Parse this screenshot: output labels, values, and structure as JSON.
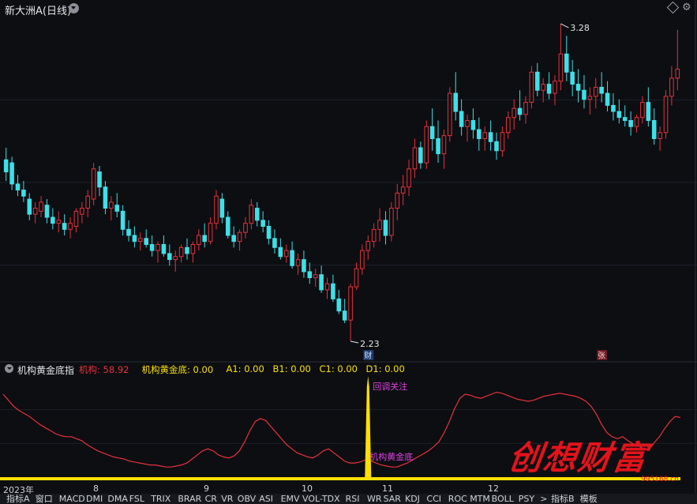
{
  "window": {
    "title": "新大洲A(日线)"
  },
  "chart_data": [
    {
      "type": "candlestick",
      "name": "新大洲A(日线)",
      "period": "日线",
      "y_range": [
        2.23,
        3.28
      ],
      "annotations": {
        "high_label": "3.28",
        "low_label": "2.23",
        "marker_cai": "财",
        "marker_zhang": "张"
      },
      "x_ticks": [
        "2023年",
        "8",
        "9",
        "10",
        "11",
        "12"
      ],
      "ohlc": [
        [
          2.83,
          2.87,
          2.76,
          2.79
        ],
        [
          2.82,
          2.84,
          2.73,
          2.75
        ],
        [
          2.75,
          2.78,
          2.71,
          2.73
        ],
        [
          2.73,
          2.76,
          2.69,
          2.71
        ],
        [
          2.7,
          2.72,
          2.63,
          2.65
        ],
        [
          2.65,
          2.69,
          2.62,
          2.67
        ],
        [
          2.66,
          2.71,
          2.64,
          2.69
        ],
        [
          2.68,
          2.7,
          2.62,
          2.64
        ],
        [
          2.64,
          2.67,
          2.6,
          2.62
        ],
        [
          2.62,
          2.66,
          2.59,
          2.63
        ],
        [
          2.62,
          2.65,
          2.58,
          2.6
        ],
        [
          2.6,
          2.64,
          2.57,
          2.62
        ],
        [
          2.61,
          2.67,
          2.59,
          2.66
        ],
        [
          2.65,
          2.69,
          2.62,
          2.67
        ],
        [
          2.67,
          2.73,
          2.64,
          2.71
        ],
        [
          2.7,
          2.82,
          2.68,
          2.8
        ],
        [
          2.79,
          2.81,
          2.71,
          2.74
        ],
        [
          2.74,
          2.76,
          2.65,
          2.67
        ],
        [
          2.67,
          2.71,
          2.63,
          2.69
        ],
        [
          2.68,
          2.72,
          2.64,
          2.66
        ],
        [
          2.66,
          2.68,
          2.58,
          2.6
        ],
        [
          2.6,
          2.63,
          2.56,
          2.58
        ],
        [
          2.58,
          2.61,
          2.54,
          2.56
        ],
        [
          2.56,
          2.59,
          2.53,
          2.57
        ],
        [
          2.57,
          2.6,
          2.54,
          2.55
        ],
        [
          2.55,
          2.58,
          2.51,
          2.53
        ],
        [
          2.53,
          2.56,
          2.49,
          2.55
        ],
        [
          2.55,
          2.58,
          2.51,
          2.52
        ],
        [
          2.52,
          2.55,
          2.48,
          2.5
        ],
        [
          2.5,
          2.53,
          2.46,
          2.51
        ],
        [
          2.51,
          2.55,
          2.49,
          2.54
        ],
        [
          2.54,
          2.57,
          2.5,
          2.52
        ],
        [
          2.52,
          2.56,
          2.49,
          2.55
        ],
        [
          2.55,
          2.6,
          2.53,
          2.58
        ],
        [
          2.58,
          2.62,
          2.54,
          2.56
        ],
        [
          2.56,
          2.64,
          2.55,
          2.62
        ],
        [
          2.62,
          2.73,
          2.6,
          2.71
        ],
        [
          2.7,
          2.72,
          2.62,
          2.64
        ],
        [
          2.64,
          2.66,
          2.57,
          2.58
        ],
        [
          2.58,
          2.61,
          2.54,
          2.56
        ],
        [
          2.56,
          2.6,
          2.53,
          2.59
        ],
        [
          2.59,
          2.64,
          2.57,
          2.62
        ],
        [
          2.62,
          2.7,
          2.6,
          2.68
        ],
        [
          2.67,
          2.69,
          2.61,
          2.63
        ],
        [
          2.63,
          2.66,
          2.59,
          2.61
        ],
        [
          2.61,
          2.63,
          2.55,
          2.57
        ],
        [
          2.57,
          2.6,
          2.52,
          2.54
        ],
        [
          2.54,
          2.57,
          2.5,
          2.51
        ],
        [
          2.51,
          2.55,
          2.49,
          2.53
        ],
        [
          2.53,
          2.56,
          2.47,
          2.48
        ],
        [
          2.48,
          2.52,
          2.45,
          2.5
        ],
        [
          2.5,
          2.53,
          2.44,
          2.46
        ],
        [
          2.46,
          2.49,
          2.42,
          2.44
        ],
        [
          2.44,
          2.47,
          2.41,
          2.45
        ],
        [
          2.45,
          2.48,
          2.39,
          2.4
        ],
        [
          2.4,
          2.44,
          2.37,
          2.42
        ],
        [
          2.42,
          2.45,
          2.36,
          2.37
        ],
        [
          2.37,
          2.4,
          2.32,
          2.33
        ],
        [
          2.33,
          2.37,
          2.29,
          2.3
        ],
        [
          2.3,
          2.42,
          2.23,
          2.41
        ],
        [
          2.41,
          2.49,
          2.4,
          2.47
        ],
        [
          2.47,
          2.55,
          2.45,
          2.53
        ],
        [
          2.53,
          2.58,
          2.5,
          2.56
        ],
        [
          2.56,
          2.62,
          2.54,
          2.6
        ],
        [
          2.6,
          2.67,
          2.56,
          2.63
        ],
        [
          2.63,
          2.66,
          2.55,
          2.58
        ],
        [
          2.58,
          2.69,
          2.56,
          2.67
        ],
        [
          2.67,
          2.75,
          2.63,
          2.72
        ],
        [
          2.72,
          2.78,
          2.68,
          2.74
        ],
        [
          2.74,
          2.83,
          2.71,
          2.8
        ],
        [
          2.8,
          2.9,
          2.77,
          2.87
        ],
        [
          2.87,
          2.89,
          2.8,
          2.82
        ],
        [
          2.82,
          2.96,
          2.8,
          2.94
        ],
        [
          2.94,
          3.0,
          2.86,
          2.9
        ],
        [
          2.9,
          2.96,
          2.82,
          2.85
        ],
        [
          2.85,
          2.93,
          2.8,
          2.91
        ],
        [
          2.91,
          3.07,
          2.89,
          3.05
        ],
        [
          3.05,
          3.12,
          2.96,
          2.99
        ],
        [
          2.99,
          3.03,
          2.91,
          2.94
        ],
        [
          2.94,
          2.98,
          2.89,
          2.96
        ],
        [
          2.96,
          3.0,
          2.9,
          2.93
        ],
        [
          2.93,
          2.97,
          2.86,
          2.9
        ],
        [
          2.9,
          2.94,
          2.86,
          2.92
        ],
        [
          2.92,
          2.96,
          2.86,
          2.89
        ],
        [
          2.89,
          2.92,
          2.83,
          2.86
        ],
        [
          2.86,
          2.94,
          2.84,
          2.92
        ],
        [
          2.92,
          2.99,
          2.9,
          2.97
        ],
        [
          2.97,
          3.03,
          2.93,
          3.0
        ],
        [
          3.0,
          3.06,
          2.96,
          2.98
        ],
        [
          2.98,
          3.04,
          2.95,
          3.02
        ],
        [
          3.02,
          3.14,
          3.0,
          3.12
        ],
        [
          3.12,
          3.15,
          3.04,
          3.06
        ],
        [
          3.06,
          3.1,
          3.02,
          3.08
        ],
        [
          3.08,
          3.12,
          3.03,
          3.05
        ],
        [
          3.05,
          3.11,
          3.01,
          3.09
        ],
        [
          3.09,
          3.28,
          3.06,
          3.18
        ],
        [
          3.18,
          3.24,
          3.09,
          3.12
        ],
        [
          3.12,
          3.16,
          3.04,
          3.08
        ],
        [
          3.08,
          3.13,
          3.02,
          3.06
        ],
        [
          3.06,
          3.11,
          3.0,
          3.03
        ],
        [
          3.03,
          3.07,
          2.98,
          3.04
        ],
        [
          3.04,
          3.1,
          3.0,
          3.07
        ],
        [
          3.07,
          3.12,
          3.02,
          3.05
        ],
        [
          3.05,
          3.09,
          2.99,
          3.01
        ],
        [
          3.01,
          3.05,
          2.96,
          2.99
        ],
        [
          2.99,
          3.03,
          2.95,
          2.97
        ],
        [
          2.97,
          3.01,
          2.94,
          2.96
        ],
        [
          2.96,
          2.99,
          2.91,
          2.94
        ],
        [
          2.94,
          2.98,
          2.92,
          2.97
        ],
        [
          2.97,
          3.04,
          2.95,
          3.02
        ],
        [
          3.02,
          3.07,
          2.94,
          2.96
        ],
        [
          2.96,
          3.0,
          2.88,
          2.9
        ],
        [
          2.9,
          2.94,
          2.86,
          2.92
        ],
        [
          2.92,
          3.06,
          2.9,
          3.04
        ],
        [
          3.04,
          3.14,
          3.01,
          3.1
        ],
        [
          3.1,
          3.26,
          3.06,
          3.13
        ]
      ]
    },
    {
      "type": "line",
      "name": "机构黄金底指",
      "header": {
        "name": "机构黄金底指",
        "series": [
          {
            "label": "机构:",
            "value": "58.92",
            "color": "#e8313a"
          },
          {
            "label": "机构黄金底:",
            "value": "0.00",
            "color": "#ffe000"
          },
          {
            "label": "A1:",
            "value": "0.00",
            "color": "#ffe000"
          },
          {
            "label": "B1:",
            "value": "0.00",
            "color": "#ffe000"
          },
          {
            "label": "C1:",
            "value": "0.00",
            "color": "#ffe000"
          },
          {
            "label": "D1:",
            "value": "0.00",
            "color": "#ffe000"
          }
        ]
      },
      "annotations": {
        "callout_top": "回调关注",
        "callout_bottom": "机构黄金底"
      },
      "jigou": [
        82,
        76,
        70,
        66,
        63,
        60,
        56,
        52,
        49,
        46,
        43,
        41,
        40,
        40,
        38,
        36,
        32,
        29,
        26,
        24,
        22,
        20,
        19,
        18,
        16,
        15,
        14,
        13,
        12,
        12,
        11,
        10,
        10,
        11,
        12,
        14,
        18,
        22,
        26,
        28,
        26,
        22,
        20,
        19,
        21,
        26,
        35,
        46,
        55,
        58,
        56,
        50,
        44,
        38,
        32,
        28,
        24,
        22,
        20,
        19,
        22,
        26,
        28,
        24,
        20,
        16,
        14,
        14,
        15,
        17,
        16,
        14,
        12,
        11,
        10,
        10,
        12,
        14,
        17,
        20,
        23,
        26,
        30,
        35,
        44,
        55,
        68,
        78,
        82,
        81,
        79,
        78,
        80,
        82,
        84,
        83,
        81,
        79,
        77,
        76,
        75,
        76,
        78,
        80,
        81,
        82,
        83,
        82,
        81,
        80,
        78,
        75,
        70,
        62,
        52,
        44,
        40,
        38,
        40,
        36,
        33,
        31,
        28,
        27,
        34,
        40,
        48,
        55,
        60,
        59
      ],
      "gold_spike_at": 62,
      "gold_spike_value": 100,
      "line_color": "#e8313a",
      "bar_color": "#ffe000"
    }
  ],
  "watermark": {
    "text": "创想财富",
    "url": "995168.cn"
  },
  "tabs": [
    "指标A",
    "窗口",
    "MACD",
    "DMI",
    "DMA",
    "FSL",
    "TRIX",
    "BRAR",
    "CR",
    "VR",
    "OBV",
    "ASI",
    "EMV",
    "VOL-TDX",
    "RSI",
    "WR",
    "SAR",
    "KDJ",
    "CCI",
    "ROC",
    "MTM",
    "BOLL",
    "PSY",
    ">",
    "指标B",
    "模板"
  ],
  "colors": {
    "up": "#e8313a",
    "down": "#3de0e8",
    "background": "#0c0e12",
    "grid": "#1c2027"
  }
}
